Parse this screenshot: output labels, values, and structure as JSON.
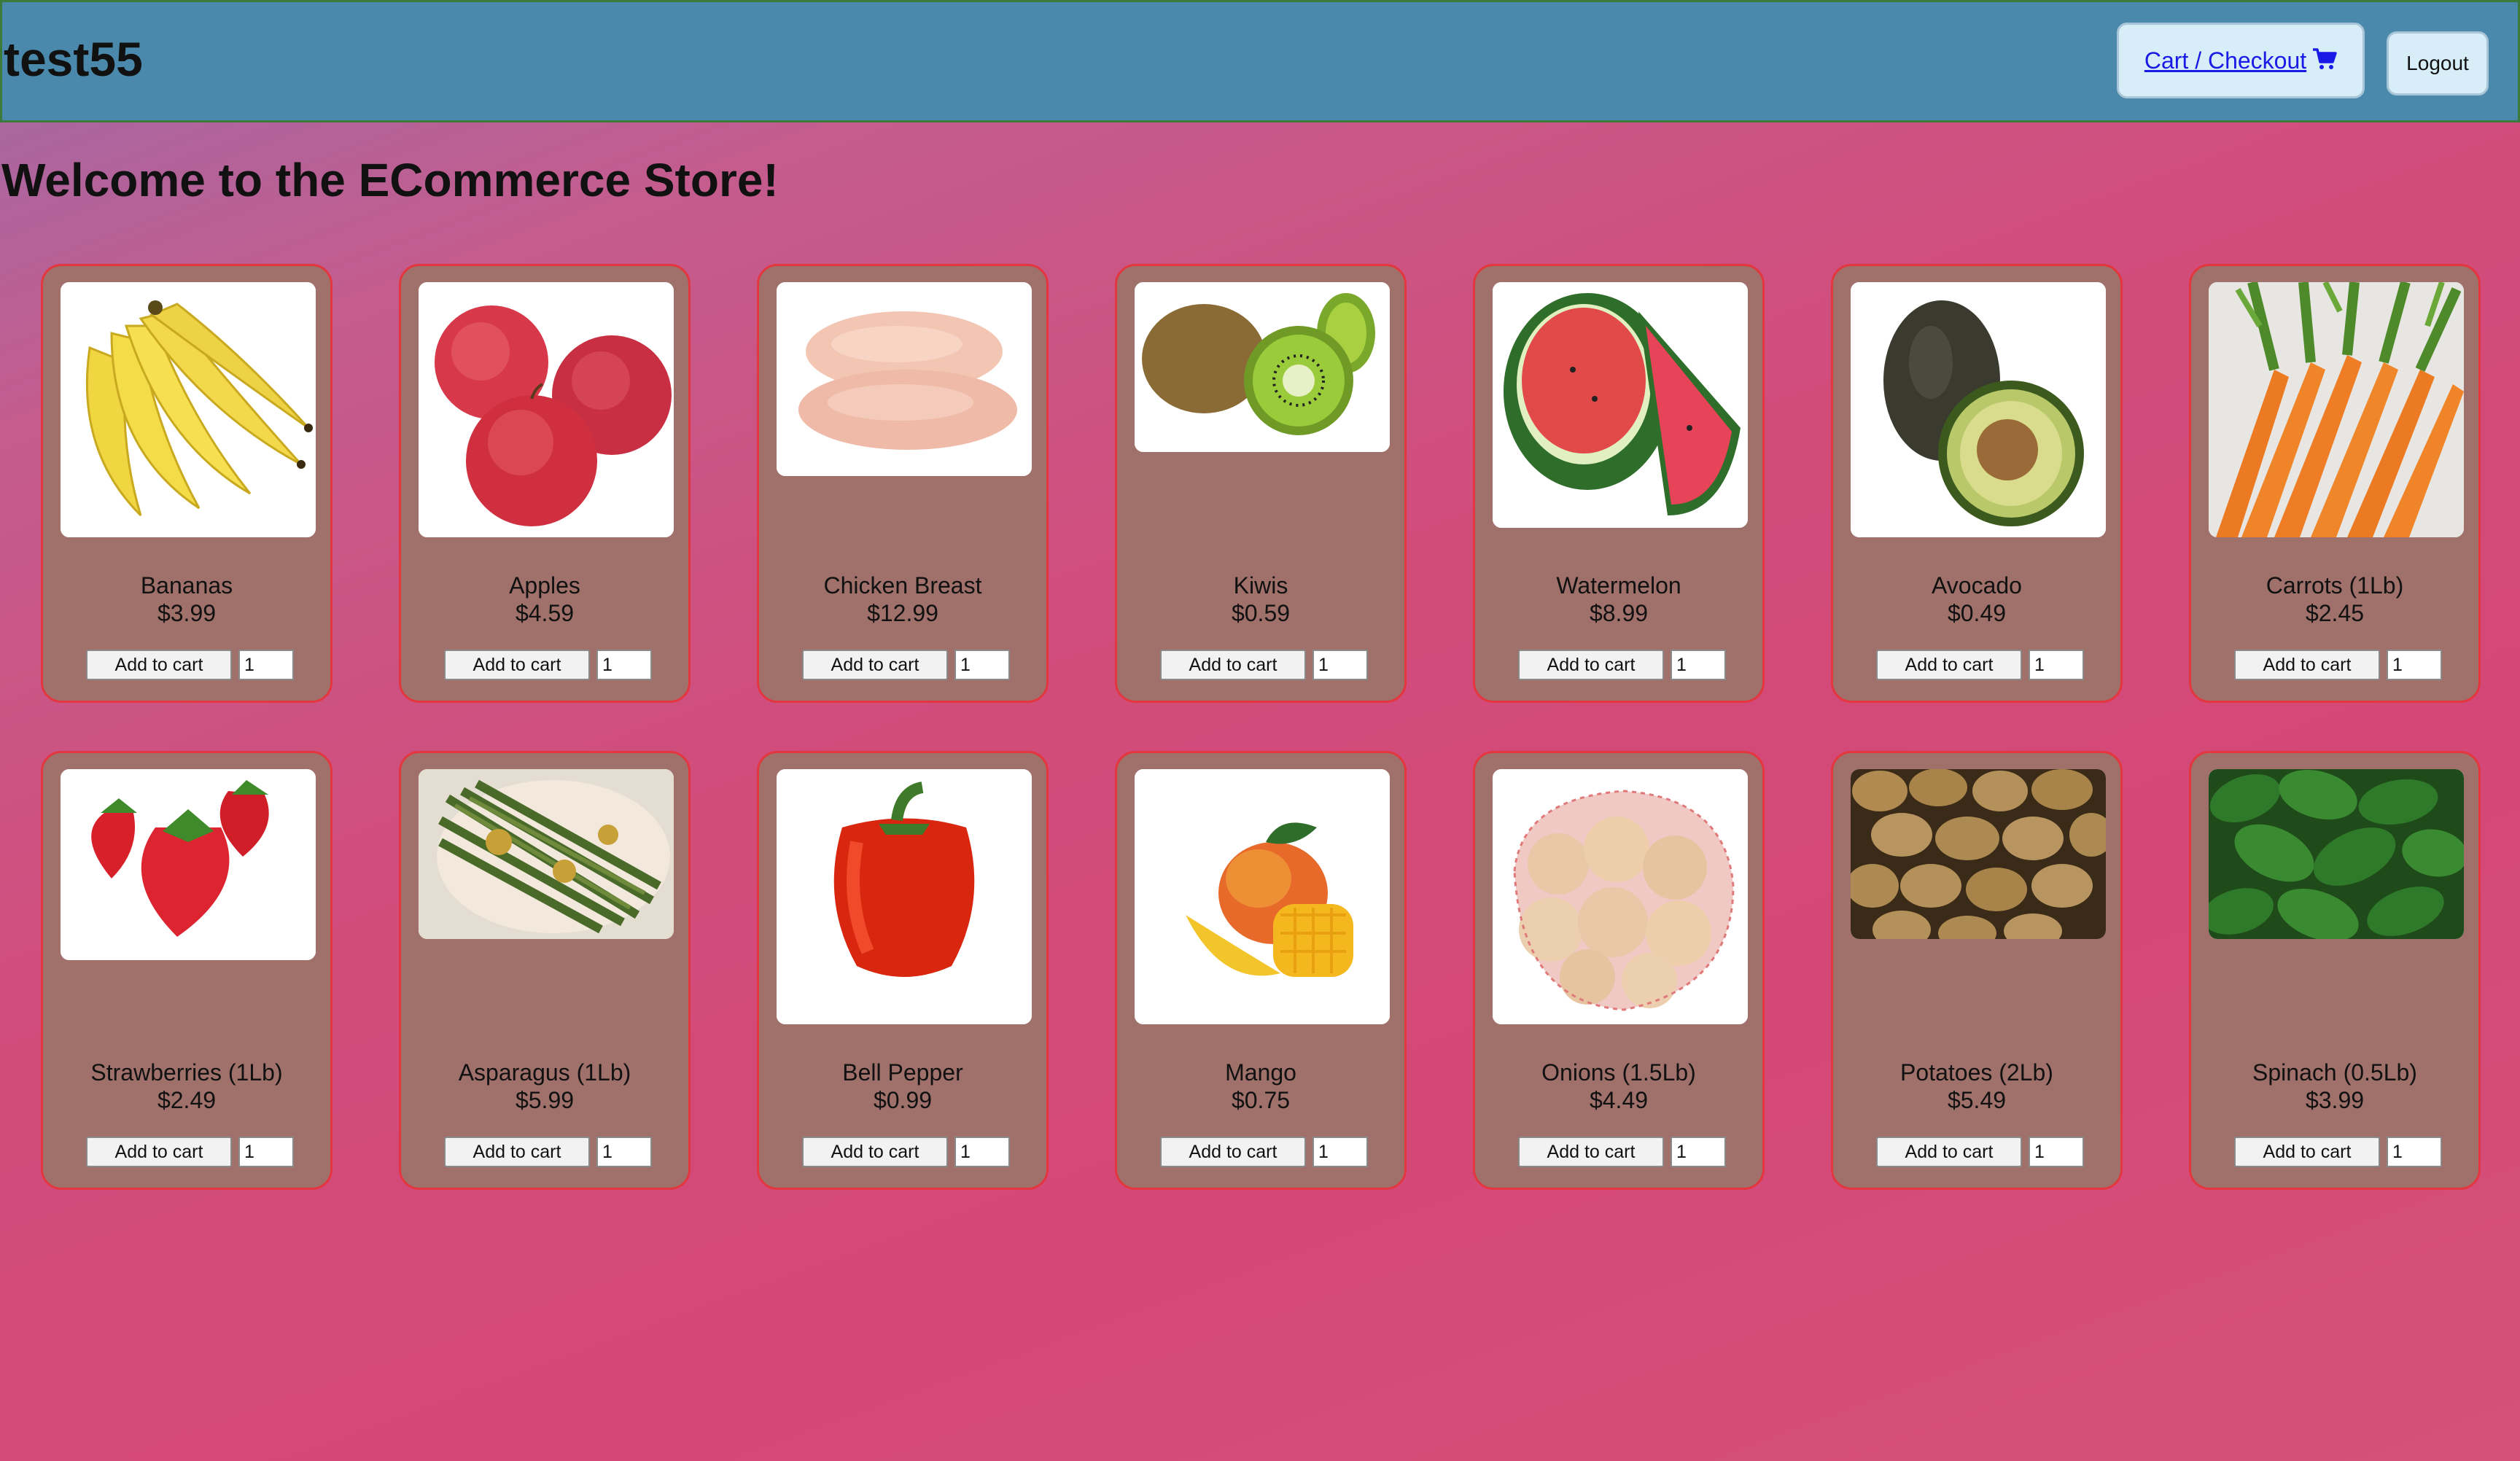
{
  "header": {
    "brand": "test55",
    "cart_label": "Cart / Checkout",
    "logout_label": "Logout"
  },
  "main": {
    "welcome": "Welcome to the ECommerce Store!"
  },
  "products": [
    {
      "name": "Bananas",
      "price": "$3.99",
      "add_label": "Add to cart",
      "qty": "1",
      "image": "bananas-image"
    },
    {
      "name": "Apples",
      "price": "$4.59",
      "add_label": "Add to cart",
      "qty": "1",
      "image": "apples-image"
    },
    {
      "name": "Chicken Breast",
      "price": "$12.99",
      "add_label": "Add to cart",
      "qty": "1",
      "image": "chicken-breast-image"
    },
    {
      "name": "Kiwis",
      "price": "$0.59",
      "add_label": "Add to cart",
      "qty": "1",
      "image": "kiwis-image"
    },
    {
      "name": "Watermelon",
      "price": "$8.99",
      "add_label": "Add to cart",
      "qty": "1",
      "image": "watermelon-image"
    },
    {
      "name": "Avocado",
      "price": "$0.49",
      "add_label": "Add to cart",
      "qty": "1",
      "image": "avocado-image"
    },
    {
      "name": "Carrots (1Lb)",
      "price": "$2.45",
      "add_label": "Add to cart",
      "qty": "1",
      "image": "carrots-image"
    },
    {
      "name": "Strawberries (1Lb)",
      "price": "$2.49",
      "add_label": "Add to cart",
      "qty": "1",
      "image": "strawberries-image"
    },
    {
      "name": "Asparagus (1Lb)",
      "price": "$5.99",
      "add_label": "Add to cart",
      "qty": "1",
      "image": "asparagus-image"
    },
    {
      "name": "Bell Pepper",
      "price": "$0.99",
      "add_label": "Add to cart",
      "qty": "1",
      "image": "bell-pepper-image"
    },
    {
      "name": "Mango",
      "price": "$0.75",
      "add_label": "Add to cart",
      "qty": "1",
      "image": "mango-image"
    },
    {
      "name": "Onions (1.5Lb)",
      "price": "$4.49",
      "add_label": "Add to cart",
      "qty": "1",
      "image": "onions-image"
    },
    {
      "name": "Potatoes (2Lb)",
      "price": "$5.49",
      "add_label": "Add to cart",
      "qty": "1",
      "image": "potatoes-image"
    },
    {
      "name": "Spinach (0.5Lb)",
      "price": "$3.99",
      "add_label": "Add to cart",
      "qty": "1",
      "image": "spinach-image"
    }
  ],
  "colors": {
    "header_bg": "#4a89ab",
    "card_bg": "#a0716a",
    "card_border": "#e4363e",
    "link": "#1a1ae6"
  }
}
